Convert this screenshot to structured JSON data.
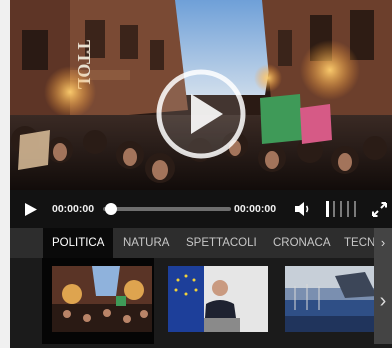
{
  "player": {
    "current_time": "00:00:00",
    "duration": "00:00:00",
    "progress": 0.0,
    "volume_level": 0.4
  },
  "video": {
    "sign_text": "TTOL"
  },
  "tabs": [
    {
      "label": "POLITICA",
      "active": true
    },
    {
      "label": "NATURA",
      "active": false
    },
    {
      "label": "SPETTACOLI",
      "active": false
    },
    {
      "label": "CRONACA",
      "active": false
    },
    {
      "label": "TECNOLOGIA",
      "active": false
    }
  ],
  "thumbnails": [
    {
      "subject": "crowd-street-night",
      "active": true
    },
    {
      "subject": "press-conference-eu-flag",
      "active": false
    },
    {
      "subject": "harbor-ships",
      "active": false
    }
  ],
  "icons": {
    "play": "play-icon",
    "big_play": "big-play-icon",
    "volume": "volume-icon",
    "fullscreen": "fullscreen-icon",
    "next": "chevron-right-icon"
  },
  "colors": {
    "control_bar": "#121212",
    "tab_bar": "#2d2d2d",
    "tab_active": "#0a0a0a",
    "accent": "#ffffff"
  }
}
